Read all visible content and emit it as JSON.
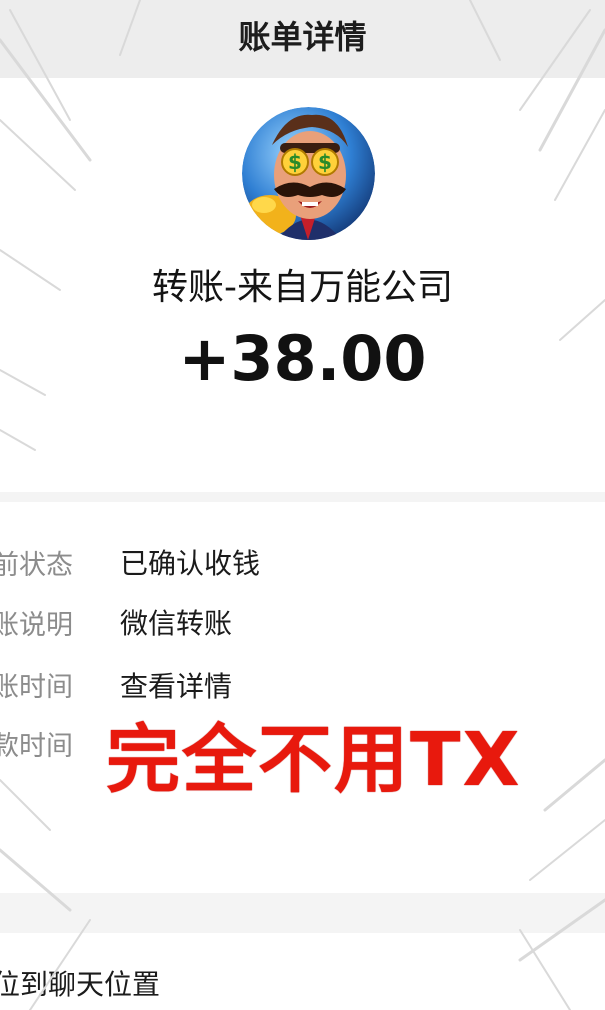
{
  "header": {
    "title": "账单详情"
  },
  "transaction": {
    "payer": "转账-来自万能公司",
    "amount": "+38.00"
  },
  "details": {
    "rows": [
      {
        "label": "前状态",
        "value": "已确认收钱"
      },
      {
        "label": "账说明",
        "value": "微信转账"
      },
      {
        "label": "账时间",
        "value": "查看详情"
      },
      {
        "label": "款时间",
        "value": ""
      }
    ]
  },
  "overlay": {
    "text": "完全不用TX"
  },
  "footer": {
    "locate_label": "位到聊天位置"
  },
  "colors": {
    "header_bg": "#ededed",
    "overlay_red": "#e8190d",
    "label_gray": "#8c8c8c"
  },
  "icons": {
    "avatar": "cartoon-rich-man-avatar"
  }
}
